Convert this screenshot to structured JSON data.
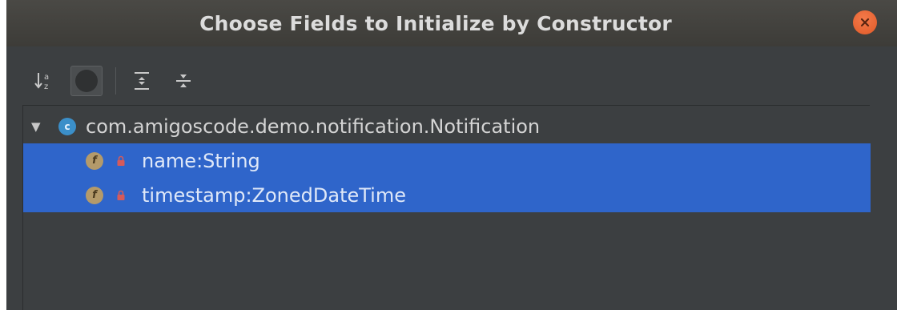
{
  "dialog": {
    "title": "Choose Fields to Initialize by Constructor"
  },
  "toolbar": {
    "sort_icon": "sort-alphabetically-icon",
    "toggle_icon": "show-inherited-toggle-icon",
    "expand_icon": "expand-all-icon",
    "collapse_icon": "collapse-all-icon"
  },
  "tree": {
    "class": {
      "icon_letter": "c",
      "name": "com.amigoscode.demo.notification.Notification"
    },
    "fields": [
      {
        "icon_letter": "f",
        "label": "name:String",
        "selected": true
      },
      {
        "icon_letter": "f",
        "label": "timestamp:ZonedDateTime",
        "selected": true
      }
    ]
  },
  "colors": {
    "dialog_bg": "#3c3f41",
    "selection": "#2f65ca",
    "close_button": "#e8643a",
    "class_icon": "#3b8fc9",
    "field_icon": "#b49a6a",
    "lock_icon": "#d65a5a"
  }
}
